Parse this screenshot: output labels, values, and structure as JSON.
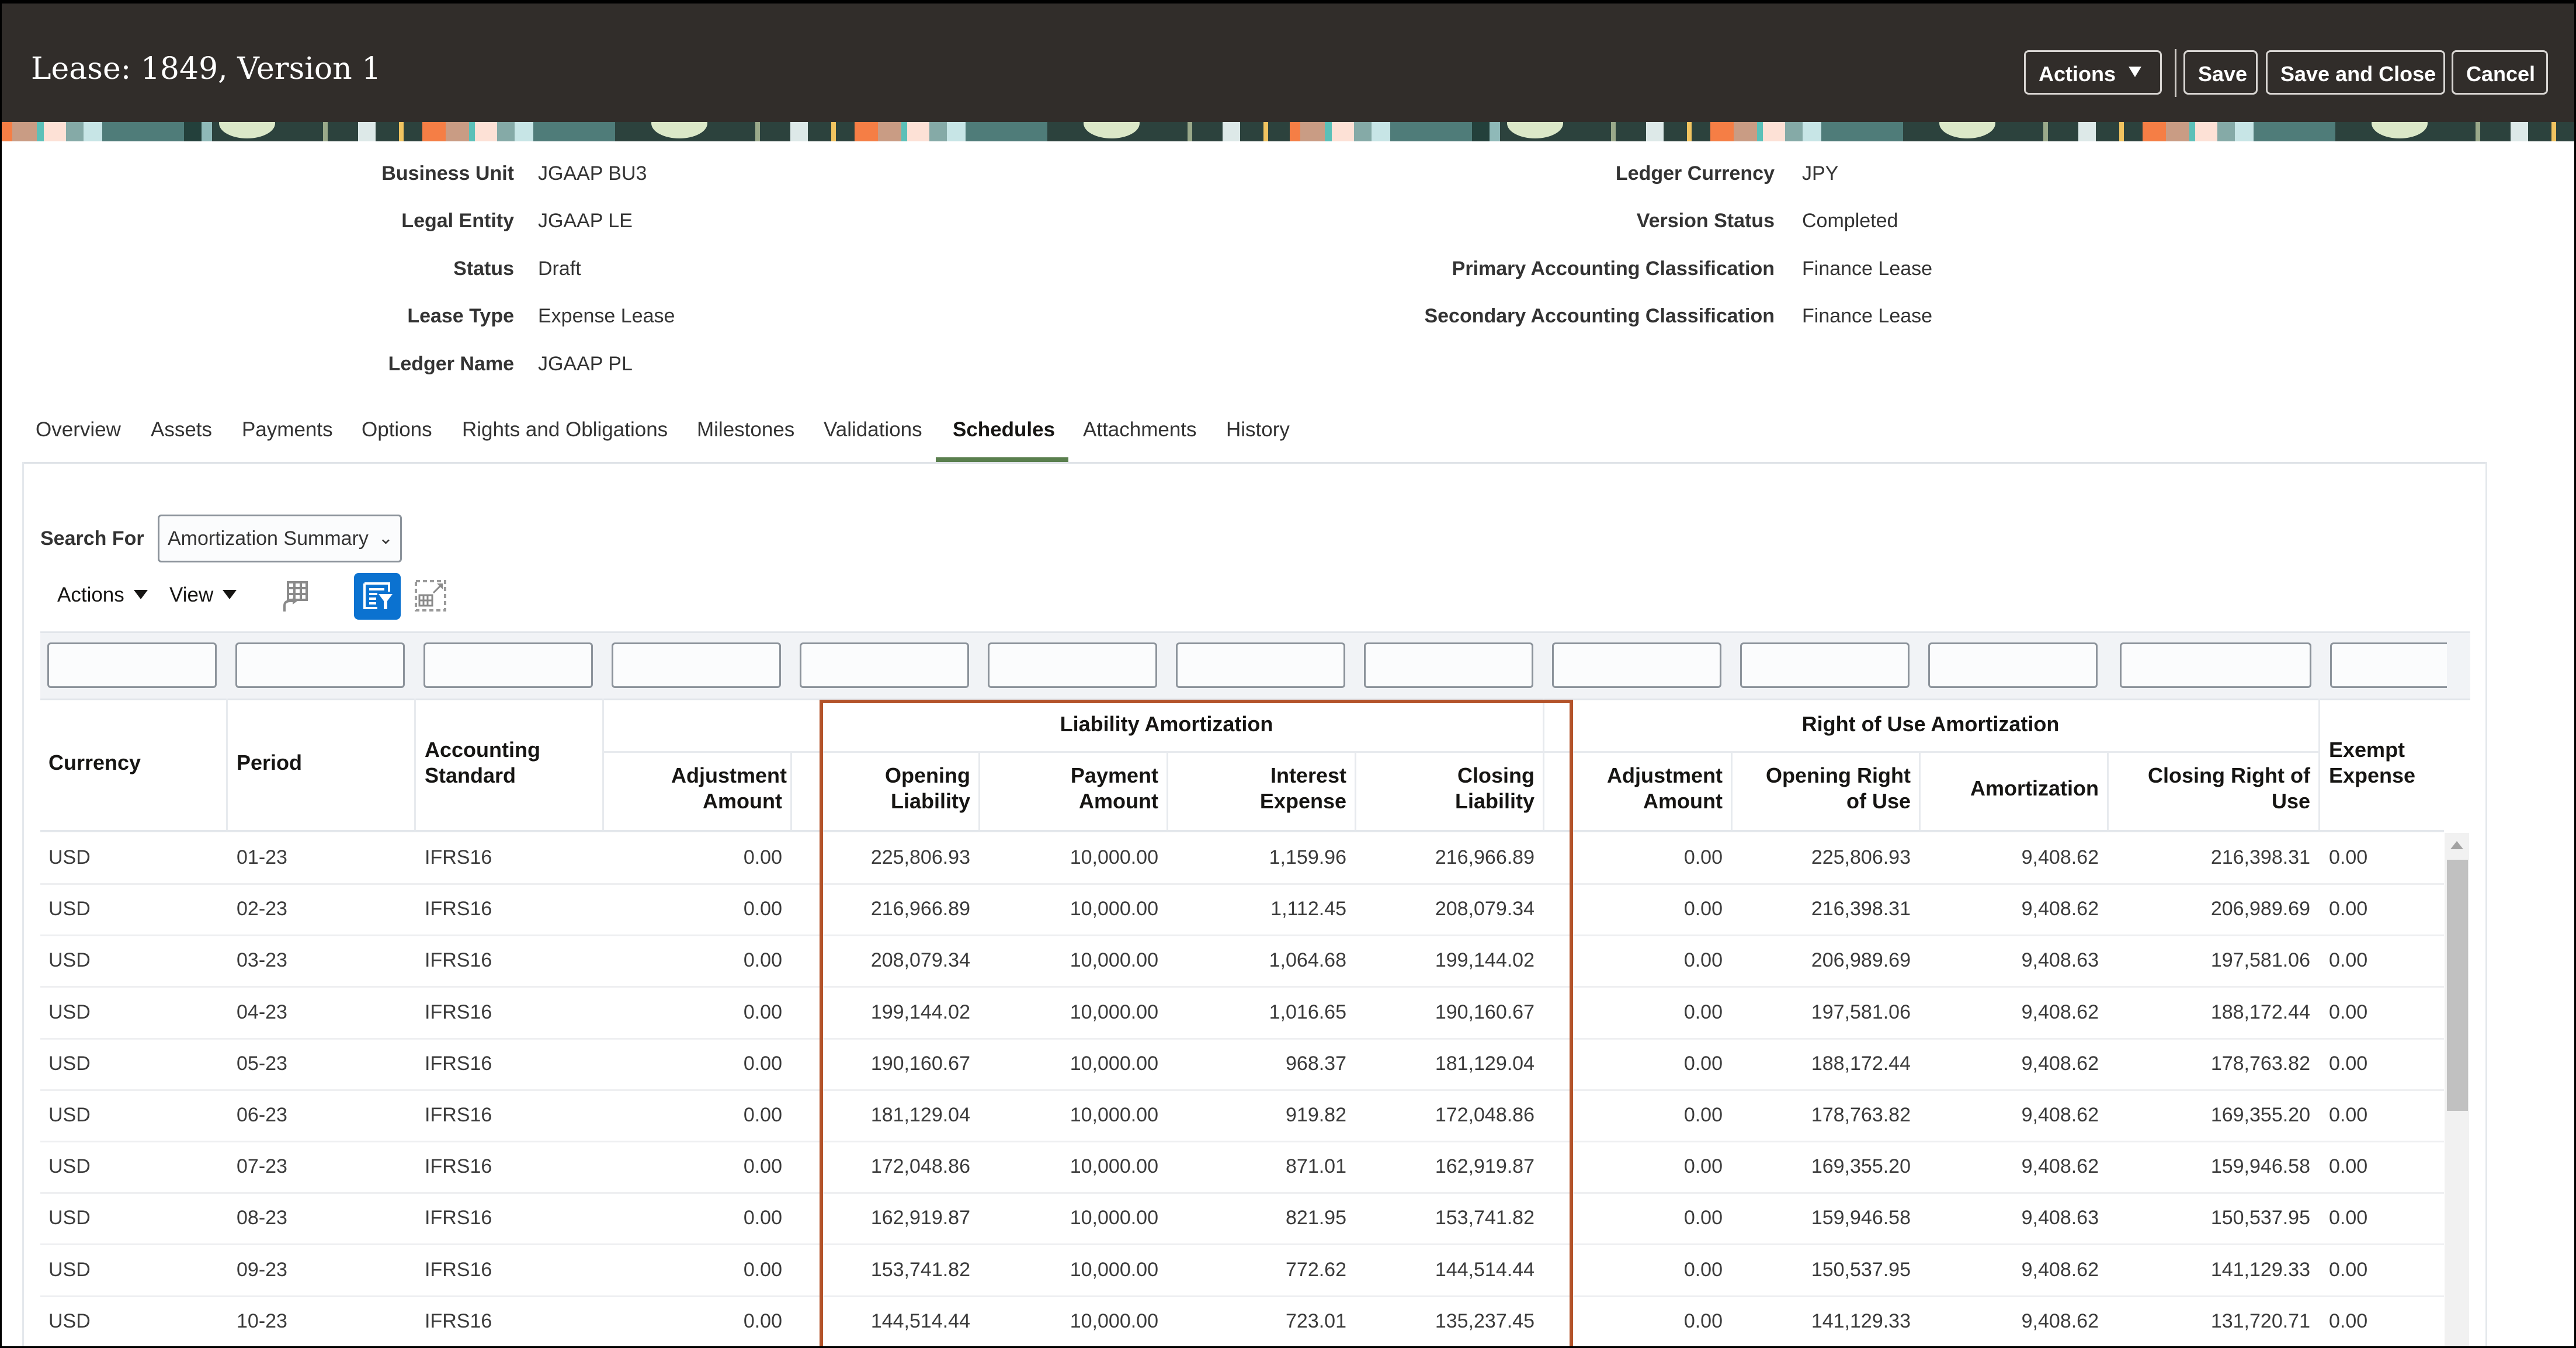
{
  "header": {
    "title": "Lease: 1849, Version 1",
    "actions_label": "Actions",
    "save_label": "Save",
    "save_close_label": "Save and Close",
    "cancel_label": "Cancel",
    "background_color": "#312d2a"
  },
  "details": {
    "left": [
      {
        "label": "Business Unit",
        "value": "JGAAP BU3"
      },
      {
        "label": "Legal Entity",
        "value": "JGAAP LE"
      },
      {
        "label": "Status",
        "value": "Draft"
      },
      {
        "label": "Lease Type",
        "value": "Expense Lease"
      },
      {
        "label": "Ledger Name",
        "value": "JGAAP PL"
      }
    ],
    "right": [
      {
        "label": "Ledger Currency",
        "value": "JPY"
      },
      {
        "label": "Version Status",
        "value": "Completed"
      },
      {
        "label": "Primary Accounting Classification",
        "value": "Finance Lease"
      },
      {
        "label": "Secondary Accounting Classification",
        "value": "Finance Lease"
      }
    ]
  },
  "tabs": [
    {
      "label": "Overview",
      "active": false
    },
    {
      "label": "Assets",
      "active": false
    },
    {
      "label": "Payments",
      "active": false
    },
    {
      "label": "Options",
      "active": false
    },
    {
      "label": "Rights and Obligations",
      "active": false
    },
    {
      "label": "Milestones",
      "active": false
    },
    {
      "label": "Validations",
      "active": false
    },
    {
      "label": "Schedules",
      "active": true
    },
    {
      "label": "Attachments",
      "active": false
    },
    {
      "label": "History",
      "active": false
    }
  ],
  "search": {
    "label": "Search For",
    "selected": "Amortization Summary"
  },
  "toolbar": {
    "actions_label": "Actions",
    "view_label": "View",
    "icons": [
      "detach-table-icon",
      "query-by-example-icon",
      "freeze-columns-icon"
    ],
    "active_icon_color": "#0b72d0"
  },
  "table": {
    "group_headers": {
      "liability": "Liability Amortization",
      "rou": "Right of Use Amortization"
    },
    "columns": {
      "currency": "Currency",
      "period": "Period",
      "accounting_standard": "Accounting Standard",
      "adjustment_amount": "Adjustment Amount",
      "opening_liability": "Opening Liability",
      "payment_amount": "Payment Amount",
      "interest_expense": "Interest Expense",
      "closing_liability": "Closing Liability",
      "rou_adjustment_amount": "Adjustment Amount",
      "opening_rou": "Opening Right of Use",
      "amortization": "Amortization",
      "closing_rou": "Closing Right of Use",
      "exempt_expense": "Exempt Expense"
    },
    "highlight_color": "#b3532a",
    "rows": [
      [
        "USD",
        "01-23",
        "IFRS16",
        "0.00",
        "225,806.93",
        "10,000.00",
        "1,159.96",
        "216,966.89",
        "0.00",
        "225,806.93",
        "9,408.62",
        "216,398.31",
        "0.00"
      ],
      [
        "USD",
        "02-23",
        "IFRS16",
        "0.00",
        "216,966.89",
        "10,000.00",
        "1,112.45",
        "208,079.34",
        "0.00",
        "216,398.31",
        "9,408.62",
        "206,989.69",
        "0.00"
      ],
      [
        "USD",
        "03-23",
        "IFRS16",
        "0.00",
        "208,079.34",
        "10,000.00",
        "1,064.68",
        "199,144.02",
        "0.00",
        "206,989.69",
        "9,408.63",
        "197,581.06",
        "0.00"
      ],
      [
        "USD",
        "04-23",
        "IFRS16",
        "0.00",
        "199,144.02",
        "10,000.00",
        "1,016.65",
        "190,160.67",
        "0.00",
        "197,581.06",
        "9,408.62",
        "188,172.44",
        "0.00"
      ],
      [
        "USD",
        "05-23",
        "IFRS16",
        "0.00",
        "190,160.67",
        "10,000.00",
        "968.37",
        "181,129.04",
        "0.00",
        "188,172.44",
        "9,408.62",
        "178,763.82",
        "0.00"
      ],
      [
        "USD",
        "06-23",
        "IFRS16",
        "0.00",
        "181,129.04",
        "10,000.00",
        "919.82",
        "172,048.86",
        "0.00",
        "178,763.82",
        "9,408.62",
        "169,355.20",
        "0.00"
      ],
      [
        "USD",
        "07-23",
        "IFRS16",
        "0.00",
        "172,048.86",
        "10,000.00",
        "871.01",
        "162,919.87",
        "0.00",
        "169,355.20",
        "9,408.62",
        "159,946.58",
        "0.00"
      ],
      [
        "USD",
        "08-23",
        "IFRS16",
        "0.00",
        "162,919.87",
        "10,000.00",
        "821.95",
        "153,741.82",
        "0.00",
        "159,946.58",
        "9,408.63",
        "150,537.95",
        "0.00"
      ],
      [
        "USD",
        "09-23",
        "IFRS16",
        "0.00",
        "153,741.82",
        "10,000.00",
        "772.62",
        "144,514.44",
        "0.00",
        "150,537.95",
        "9,408.62",
        "141,129.33",
        "0.00"
      ],
      [
        "USD",
        "10-23",
        "IFRS16",
        "0.00",
        "144,514.44",
        "10,000.00",
        "723.01",
        "135,237.45",
        "0.00",
        "141,129.33",
        "9,408.62",
        "131,720.71",
        "0.00"
      ]
    ]
  }
}
